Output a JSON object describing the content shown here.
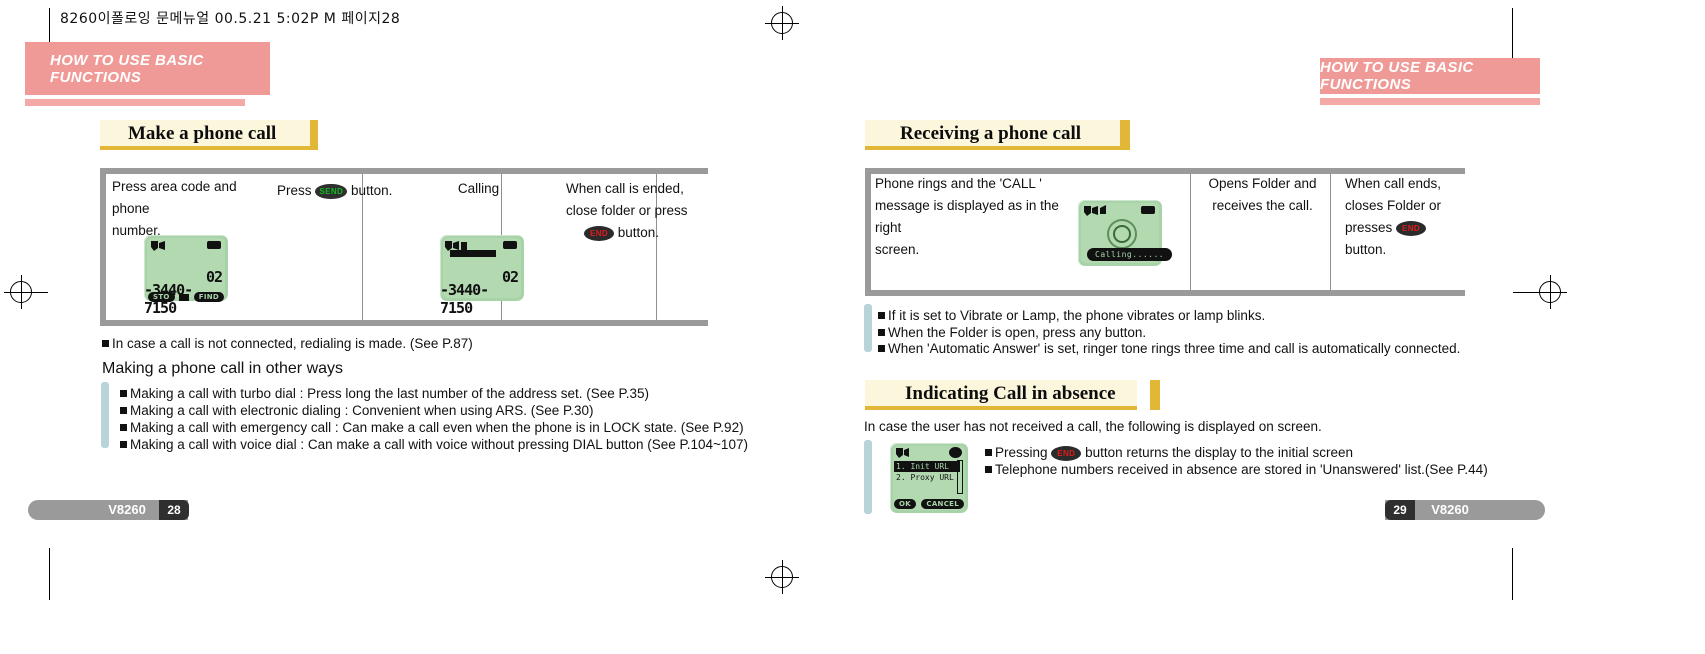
{
  "page_slug": "8260이폴로잉 문메뉴얼   00.5.21 5:02P M 페이지28",
  "chapter_banner": "HOW TO USE BASIC FUNCTIONS",
  "left_page": {
    "section_title": "Make a phone call",
    "flow_table": {
      "steps": [
        {
          "lines": [
            "Press area code and phone",
            "number."
          ]
        },
        {
          "pre": "Press",
          "key": "SEND",
          "post": "button."
        },
        {
          "lines": [
            "Calling"
          ]
        },
        {
          "lines": [
            "When call is ended,",
            "close folder or press"
          ],
          "key": "END",
          "post": "button."
        }
      ]
    },
    "lcd_one": {
      "number_line1": "02",
      "number_line2": "-3440-7150",
      "softkey_left": "STO",
      "softkey_right": "FIND"
    },
    "lcd_two": {
      "number_line1": "02",
      "number_line2": "-3440-7150"
    },
    "note": "In case a call is not connected, redialing is made. (See P.87)",
    "subheading": "Making a phone call in other ways",
    "bullets": [
      "Making a call  with turbo dial : Press  long the last number  of the address set. (See P.35)",
      "Making a call with electronic dialing : Convenient when using ARS. (See P.30)",
      "Making a call with emergency call : Can make a call even when the phone is in LOCK state. (See P.92)",
      "Making a call with voice dial : Can make a call with voice without pressing DIAL button (See P.104~107)"
    ],
    "footer": {
      "model": "V8260",
      "page": "28"
    }
  },
  "right_page": {
    "section_title": "Receiving a phone call",
    "flow_table": {
      "steps": [
        {
          "lines": [
            "Phone rings and the  'CALL '",
            "message is displayed as in the right",
            "screen."
          ]
        },
        {
          "lines": [
            "Opens Folder and",
            "receives the call."
          ]
        },
        {
          "lines": [
            "When call ends,",
            "closes Folder or"
          ],
          "pre": "presses",
          "key": "END",
          "post": "button."
        }
      ]
    },
    "lcd_calling": {
      "label": "Calling......"
    },
    "bullets": [
      "If it is set to Vibrate or Lamp, the phone vibrates or lamp blinks.",
      "When the Folder is open, press any button.",
      "When 'Automatic Answer' is set, ringer tone rings three time and call is automatically connected."
    ],
    "section_title2": "Indicating Call in absence",
    "intro": "In case the user has not received a call, the following is displayed on screen.",
    "lcd_menu": {
      "item1": "1. Init URL",
      "item2": "2. Proxy URL",
      "softkey_left": "OK",
      "softkey_right": "CANCEL"
    },
    "bullets2_pre": "Pressing",
    "bullets2_key": "END",
    "bullets2_post": "button returns the display to the initial screen",
    "bullets2_second": "Telephone numbers received in absence are stored in  'Unanswered' list.(See P.44)",
    "footer": {
      "model": "V8260",
      "page": "29"
    }
  },
  "colors": {
    "banner_pink": "#f09a97",
    "heading_yellow_bg": "#fbf6dc",
    "heading_gold": "#e2b737",
    "lcd_green": "#a8d3a8",
    "rule_grey": "#9a9a9a",
    "bluebar": "#b9d4d8",
    "send_green": "#12b820",
    "end_red": "#e01b1b"
  }
}
